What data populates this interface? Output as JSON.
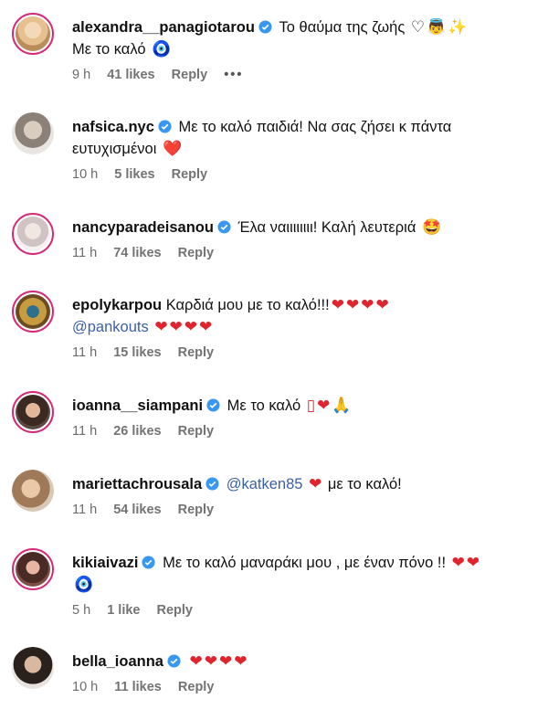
{
  "comments": [
    {
      "username": "alexandra__panagiotarou",
      "line1": "Το θαύμα της ζωής",
      "line1_emoji": "♡👼✨",
      "line2": "Με το καλό",
      "line2_emoji": "🧿",
      "time": "9 h",
      "likes": "41 likes",
      "reply": "Reply",
      "more": "•••"
    },
    {
      "username": "nafsica.nyc",
      "line1": "Με το καλό παιδιά! Να σας ζήσει κ πάντα",
      "line2": "ευτυχισμένοι",
      "line2_emoji": "❤️",
      "time": "10 h",
      "likes": "5 likes",
      "reply": "Reply"
    },
    {
      "username": "nancyparadeisanou",
      "line1": "Έλα ναιιιιιιιι! Καλή λευτεριά",
      "line1_emoji": "🤩",
      "time": "11 h",
      "likes": "74 likes",
      "reply": "Reply"
    },
    {
      "username": "epolykarpou",
      "line1": "Καρδιά μου με το καλό!!!",
      "line1_emoji": "❤❤❤❤",
      "line2_mention": "@pankouts",
      "line2_emoji": "❤❤❤❤",
      "time": "11 h",
      "likes": "15 likes",
      "reply": "Reply"
    },
    {
      "username": "ioanna__siampani",
      "line1": "Με το καλό",
      "line1_emoji": "▯❤🙏",
      "time": "11 h",
      "likes": "26 likes",
      "reply": "Reply"
    },
    {
      "username": "mariettachrousala",
      "line1_mention": "@katken85",
      "line1_emoji": "❤",
      "line1_after": "με το καλό!",
      "time": "11 h",
      "likes": "54 likes",
      "reply": "Reply"
    },
    {
      "username": "kikiaivazi",
      "line1": "Με το καλό μαναράκι μου , με έναν πόνο !!",
      "line1_emoji": "❤❤",
      "line2_emoji": "🧿",
      "time": "5 h",
      "likes": "1 like",
      "reply": "Reply"
    },
    {
      "username": "bella_ioanna",
      "line1_emoji": "❤❤❤❤",
      "time": "10 h",
      "likes": "11 likes",
      "reply": "Reply"
    }
  ],
  "colors": {
    "verified": "#3897f0",
    "heart": "#e0242e",
    "mention": "#3b5fa8",
    "meta": "#737373",
    "story_ring": "#d62976"
  },
  "icons": {
    "verified": "verified-badge-icon",
    "more": "more-options-icon"
  }
}
